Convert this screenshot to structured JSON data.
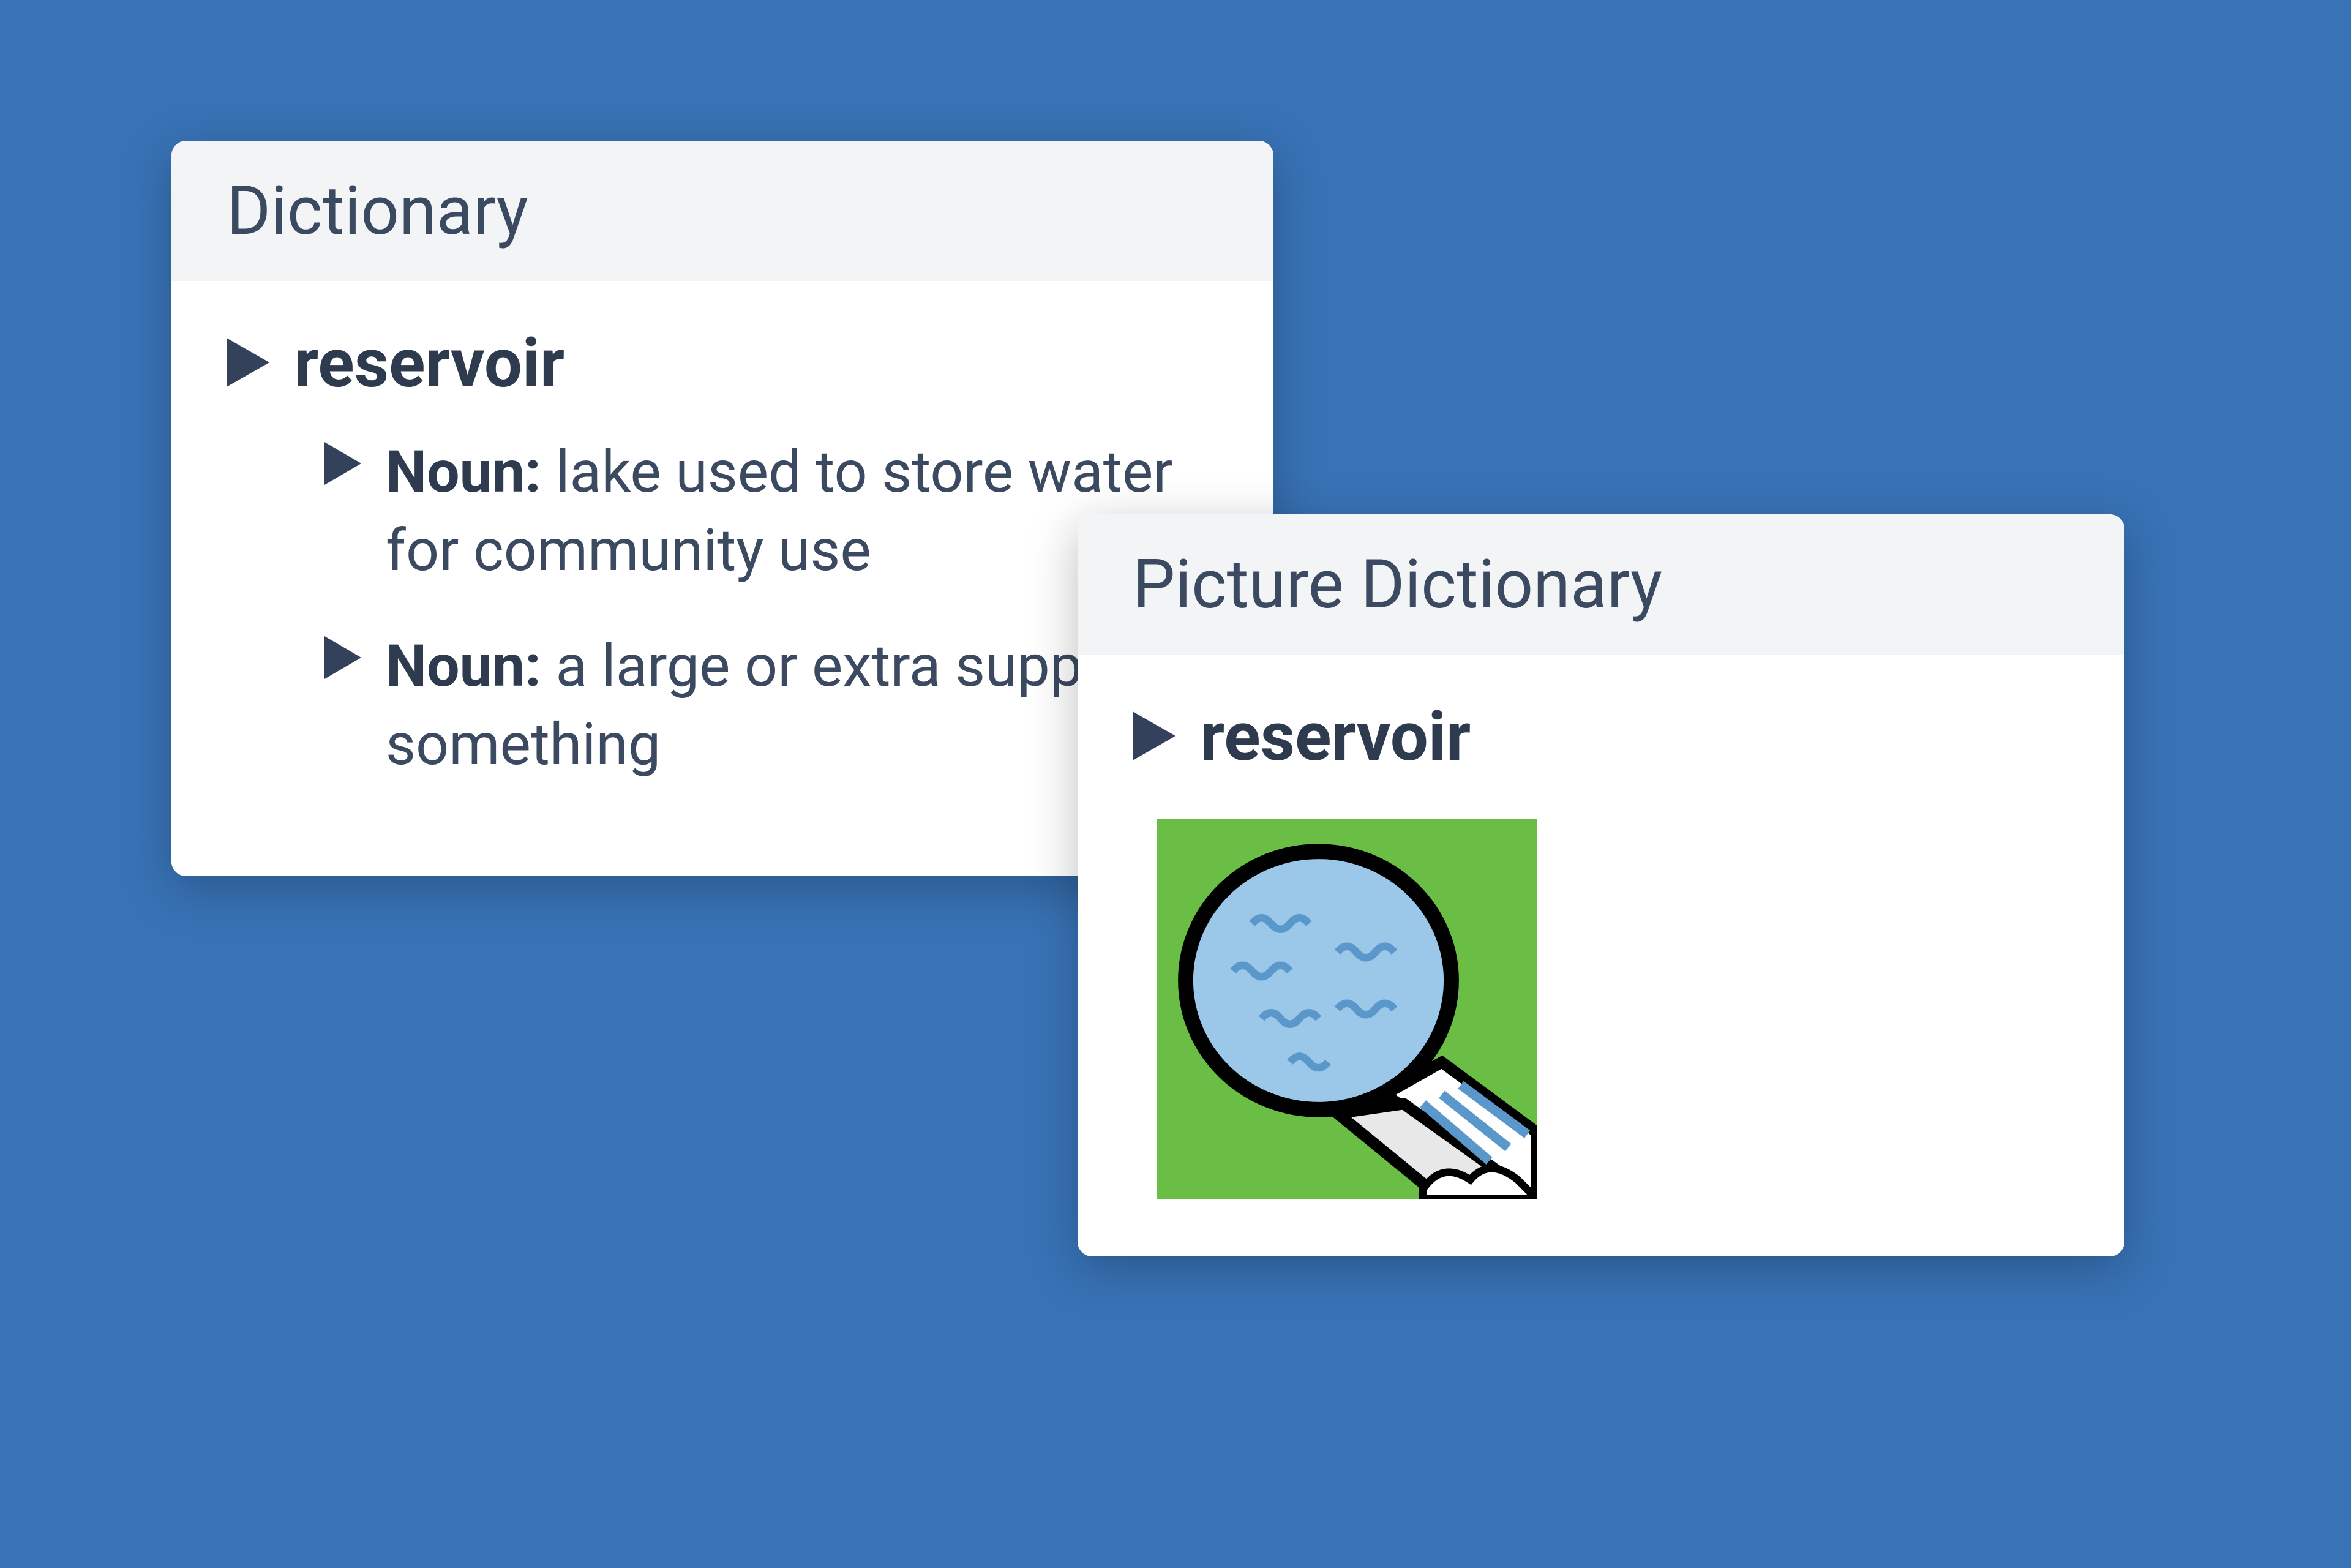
{
  "dictionary": {
    "title": "Dictionary",
    "word": "reservoir",
    "definitions": [
      {
        "part_of_speech": "Noun:",
        "text": " lake used to store water for community use"
      },
      {
        "part_of_speech": "Noun:",
        "text": " a large or extra supply of something"
      }
    ]
  },
  "picture_dictionary": {
    "title": "Picture Dictionary",
    "word": "reservoir",
    "image_alt": "reservoir-dam-illustration"
  },
  "colors": {
    "background": "#3873B6",
    "header_bg": "#F3F4F5",
    "text_dark": "#2E3B4E",
    "text_muted": "#3B4A60"
  }
}
